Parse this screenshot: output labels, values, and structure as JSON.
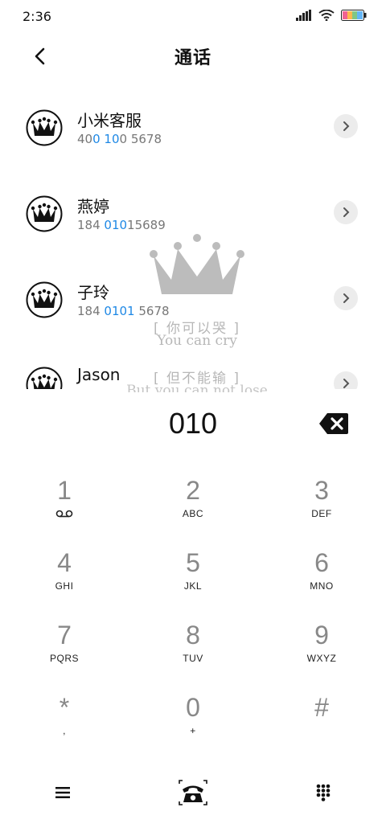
{
  "status_bar": {
    "time": "2:36"
  },
  "header": {
    "title": "通话"
  },
  "contacts": [
    {
      "name": "小米客服",
      "number_parts": [
        "40",
        "0",
        " ",
        "10",
        "0 5678"
      ]
    },
    {
      "name": "燕婷",
      "number_parts": [
        "184 ",
        "010",
        "15689"
      ]
    },
    {
      "name": "子玲",
      "number_parts": [
        "184 ",
        "0101",
        " 5678"
      ]
    },
    {
      "name": "Jason",
      "number_parts": []
    }
  ],
  "watermark": {
    "line1": "[ 你可以哭 ]",
    "line2": "You can cry",
    "line3": "[ 但不能输 ]",
    "line4": "But you can not lose"
  },
  "dialer": {
    "dialed_number": "010"
  },
  "keypad": [
    {
      "digit": "1",
      "letters": ""
    },
    {
      "digit": "2",
      "letters": "ABC"
    },
    {
      "digit": "3",
      "letters": "DEF"
    },
    {
      "digit": "4",
      "letters": "GHI"
    },
    {
      "digit": "5",
      "letters": "JKL"
    },
    {
      "digit": "6",
      "letters": "MNO"
    },
    {
      "digit": "7",
      "letters": "PQRS"
    },
    {
      "digit": "8",
      "letters": "TUV"
    },
    {
      "digit": "9",
      "letters": "WXYZ"
    },
    {
      "digit": "*",
      "letters": ","
    },
    {
      "digit": "0",
      "letters": "+"
    },
    {
      "digit": "#",
      "letters": ""
    }
  ],
  "icons": {
    "back": "chevron-left-icon",
    "detail": "chevron-right-icon",
    "backspace": "backspace-icon",
    "voicemail": "voicemail-icon",
    "menu": "menu-icon",
    "call": "phone-icon",
    "dialpad": "dialpad-icon"
  },
  "colors": {
    "highlight": "#1e88e5",
    "watermark": "#bcbcbc"
  }
}
